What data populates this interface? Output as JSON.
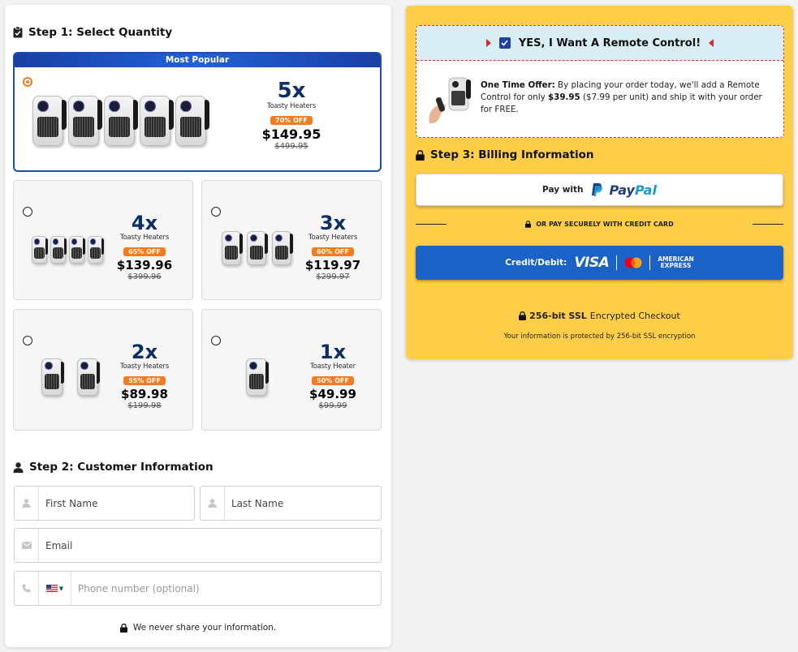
{
  "step1": {
    "title": "Step 1: Select Quantity"
  },
  "offers": {
    "popular_label": "Most Popular",
    "five": {
      "qty": "5x",
      "product": "Toasty Heaters",
      "discount": "70% OFF",
      "price": "$149.95",
      "old_price": "$499.95",
      "selected": true
    },
    "four": {
      "qty": "4x",
      "product": "Toasty Heaters",
      "discount": "65% OFF",
      "price": "$139.96",
      "old_price": "$399.96"
    },
    "three": {
      "qty": "3x",
      "product": "Toasty Heaters",
      "discount": "60% OFF",
      "price": "$119.97",
      "old_price": "$299.97"
    },
    "two": {
      "qty": "2x",
      "product": "Toasty Heaters",
      "discount": "55% OFF",
      "price": "$89.98",
      "old_price": "$199.98"
    },
    "one": {
      "qty": "1x",
      "product": "Toasty Heater",
      "discount": "50% OFF",
      "price": "$49.99",
      "old_price": "$99.99"
    }
  },
  "step2": {
    "title": "Step 2: Customer Information",
    "first_name_placeholder": "First Name",
    "last_name_placeholder": "Last Name",
    "email_placeholder": "Email",
    "phone_placeholder": "Phone number (optional)",
    "privacy_note": "We never share your information."
  },
  "upsell": {
    "heading": "YES, I Want A Remote Control!",
    "checked": true,
    "offer_label": "One Time Offer:",
    "text_1": " By placing your order today, we'll add a Remote Control for only ",
    "price": "$39.95",
    "text_2": " ($7.99 per unit) and ship it with your order for FREE."
  },
  "step3": {
    "title": "Step 3: Billing Information",
    "pay_with": "Pay with",
    "paypal_pay": "Pay",
    "paypal_pal": "Pal",
    "divider_text": "OR PAY SECURELY WITH CREDIT CARD",
    "card_label": "Credit/Debit:",
    "visa": "VISA",
    "amex_1": "AMERICAN",
    "amex_2": "EXPRESS",
    "ssl_bold": "256-bit SSL",
    "ssl_rest": "Encrypted Checkout",
    "ssl_sub": "Your information is protected by 256-bit SSL encryption"
  },
  "colors": {
    "accent_blue": "#1c4fa5",
    "orange": "#f47b20",
    "yellow_panel": "#ffce48",
    "navy": "#0e2f66",
    "card_blue": "#1b62c7"
  }
}
